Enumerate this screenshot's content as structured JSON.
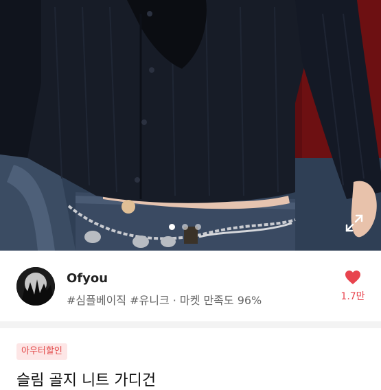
{
  "product_photo": {
    "alt": "",
    "carousel": {
      "count": 3,
      "active_index": 0
    }
  },
  "seller": {
    "name": "Ofyou",
    "tags": "#심플베이직 #유니크 · 마켓 만족도 96%",
    "like_count": "1.7만"
  },
  "product": {
    "badge": "아우터할인",
    "title": "슬림 골지 니트 가디건"
  },
  "colors": {
    "like": "#e8444e",
    "badge_bg": "#fde6e6",
    "badge_text": "#e24848"
  },
  "icons": {
    "expand": "expand-icon",
    "heart": "heart-icon"
  }
}
